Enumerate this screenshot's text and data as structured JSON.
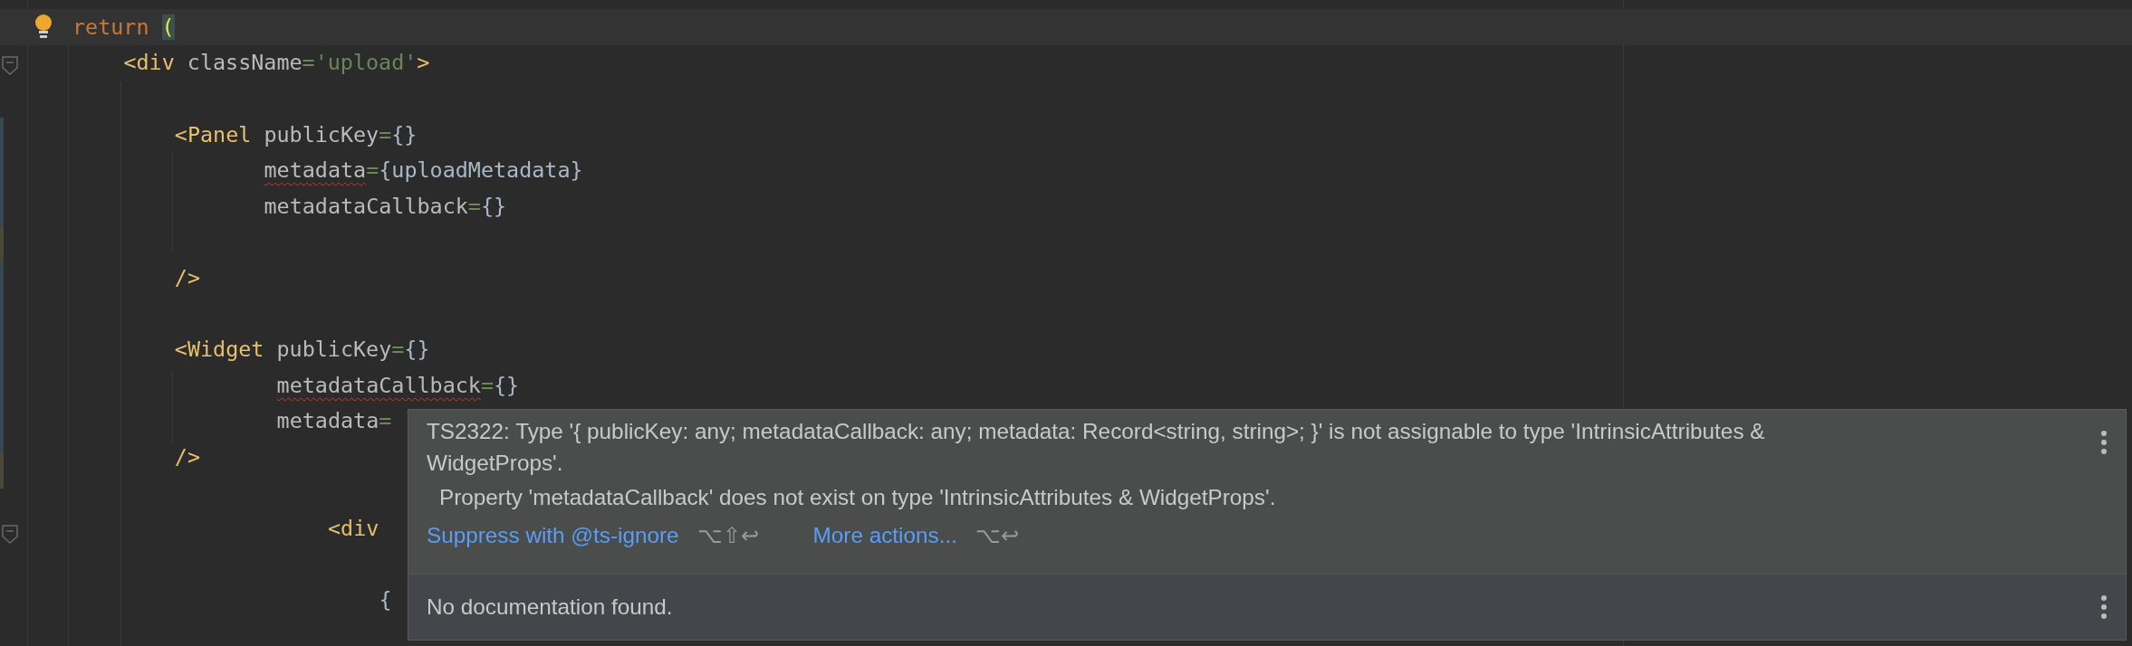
{
  "editor": {
    "lines": [
      {
        "tokens": [
          {
            "kind": "keyword",
            "text": "return"
          },
          {
            "kind": "paren",
            "text": "("
          }
        ],
        "current": true,
        "bulb": true,
        "children": [
          {
            "tokens": [
              {
                "kind": "tag",
                "text": "<div"
              },
              {
                "kind": "attr",
                "text": "className"
              },
              {
                "kind": "eq",
                "text": "="
              },
              {
                "kind": "string",
                "text": "'upload'"
              },
              {
                "kind": "tag",
                "text": ">"
              }
            ],
            "children": [
              {
                "space_before": true,
                "tokens": [
                  {
                    "kind": "tag",
                    "text": "<Panel"
                  },
                  {
                    "kind": "attr",
                    "text": "publicKey"
                  },
                  {
                    "kind": "eq",
                    "text": "="
                  },
                  {
                    "kind": "brace",
                    "text": "{}"
                  }
                ],
                "children": [
                  {
                    "kind": "attribute",
                    "tokens": [
                      {
                        "kind": "attr",
                        "text": "metadata",
                        "error": true
                      },
                      {
                        "kind": "eq",
                        "text": "="
                      },
                      {
                        "kind": "brace",
                        "text": "{uploadMetadata}"
                      }
                    ]
                  },
                  {
                    "kind": "attribute",
                    "tokens": [
                      {
                        "kind": "attr",
                        "text": "metadataCallback",
                        "error": false
                      },
                      {
                        "kind": "eq",
                        "text": "="
                      },
                      {
                        "kind": "brace",
                        "text": "{}"
                      }
                    ]
                  }
                ]
              },
              {
                "space_before": true,
                "tokens": [
                  {
                    "kind": "tag",
                    "text": "/>"
                  }
                ]
              },
              {
                "space_before": true,
                "tokens": [
                  {
                    "kind": "tag",
                    "text": "<Widget"
                  },
                  {
                    "kind": "attr",
                    "text": "publicKey"
                  },
                  {
                    "kind": "eq",
                    "text": "="
                  },
                  {
                    "kind": "brace",
                    "text": "{}"
                  }
                ],
                "children": [
                  {
                    "kind": "attribute",
                    "tokens": [
                      {
                        "kind": "attr",
                        "text": "metadataCallback",
                        "error": true
                      },
                      {
                        "kind": "eq",
                        "text": "="
                      },
                      {
                        "kind": "brace",
                        "text": "{}"
                      }
                    ]
                  },
                  {
                    "kind": "attribute",
                    "tokens": [
                      {
                        "kind": "attr",
                        "text": "metadata",
                        "error": false
                      },
                      {
                        "kind": "eq",
                        "text": "="
                      }
                    ]
                  }
                ]
              },
              {
                "tokens": [
                  {
                    "kind": "tag",
                    "text": "/>"
                  }
                ]
              },
              {
                "children": [
                  {
                    "children": [
                      {
                        "children": [
                          {
                            "space_before": true,
                            "tokens": [
                              {
                                "kind": "tag",
                                "text": "<div"
                              }
                            ],
                            "children": [
                              {
                                "space_before": true,
                                "tokens": [
                                  {
                                    "kind": "brace",
                                    "text": "{"
                                  }
                                ]
                              }
                            ]
                          }
                        ]
                      }
                    ]
                  }
                ]
              }
            ]
          }
        ]
      }
    ]
  },
  "popup": {
    "message": "TS2322: Type '{ publicKey: any; metadataCallback: any; metadata: Record<string, string>; }' is not assignable to type 'IntrinsicAttributes & WidgetProps'.",
    "detail": "Property 'metadataCallback' does not exist on type 'IntrinsicAttributes & WidgetProps'.",
    "actions": [
      {
        "label": "Suppress with @ts-ignore",
        "shortcut": "⌥⇧↩"
      },
      {
        "label": "More actions...",
        "shortcut": "⌥↩"
      }
    ],
    "documentation": "No documentation found."
  }
}
